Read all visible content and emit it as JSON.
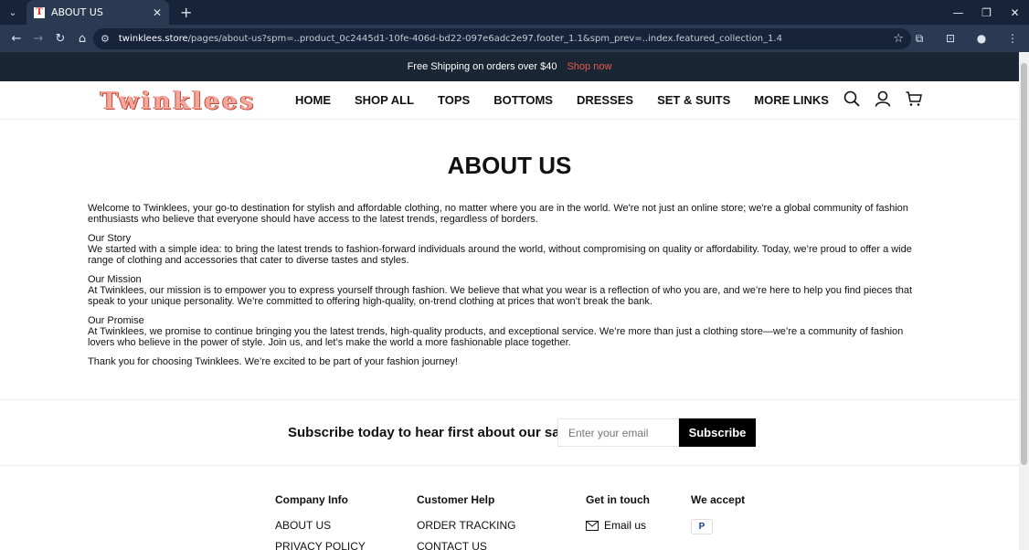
{
  "browser": {
    "tab_title": "ABOUT US",
    "tab_favicon": "T",
    "url_host": "twinklees.store",
    "url_path": "/pages/about-us?spm=..product_0c2445d1-10fe-406d-bd22-097e6adc2e97.footer_1.1&spm_prev=..index.featured_collection_1.4"
  },
  "announcement": {
    "text": "Free Shipping on orders over $40",
    "link": "Shop now"
  },
  "header": {
    "logo": "Twinklees",
    "nav": [
      "HOME",
      "SHOP ALL",
      "TOPS",
      "BOTTOMS",
      "DRESSES",
      "SET & SUITS",
      "MORE LINKS"
    ]
  },
  "main": {
    "title": "ABOUT US",
    "intro": "Welcome to Twinklees, your go-to destination for stylish and affordable clothing, no matter where you are in the world. We're not just an online store; we're a global community of fashion enthusiasts who believe that everyone should have access to the latest trends, regardless of borders.",
    "story_heading": "Our Story",
    "story": "We started with a simple idea: to bring the latest trends to fashion-forward individuals around the world, without compromising on quality or affordability. Today, we’re proud to offer a wide range of clothing and accessories that cater to diverse tastes and styles.",
    "mission_heading": "Our Mission",
    "mission": "At Twinklees, our mission is to empower you to express yourself through fashion. We believe that what you wear is a reflection of who you are, and we’re here to help you find pieces that speak to your unique personality. We’re committed to offering high-quality, on-trend clothing at prices that won’t break the bank.",
    "promise_heading": "Our Promise",
    "promise": "At Twinklees, we promise to continue bringing you the latest trends, high-quality products, and exceptional service. We’re more than just a clothing store—we’re a community of fashion lovers who believe in the power of style. Join us, and let’s make the world a more fashionable place together.",
    "closing": "Thank you for choosing Twinklees. We’re excited to be part of your fashion journey!"
  },
  "subscribe": {
    "label": "Subscribe today to hear first about our sales",
    "placeholder": "Enter your email",
    "button": "Subscribe"
  },
  "footer": {
    "company_heading": "Company Info",
    "company_links": [
      "ABOUT US",
      "PRIVACY POLICY"
    ],
    "help_heading": "Customer Help",
    "help_links": [
      "ORDER TRACKING",
      "CONTACT US"
    ],
    "touch_heading": "Get in touch",
    "email_label": "Email us",
    "accept_heading": "We accept",
    "payment": "P"
  }
}
